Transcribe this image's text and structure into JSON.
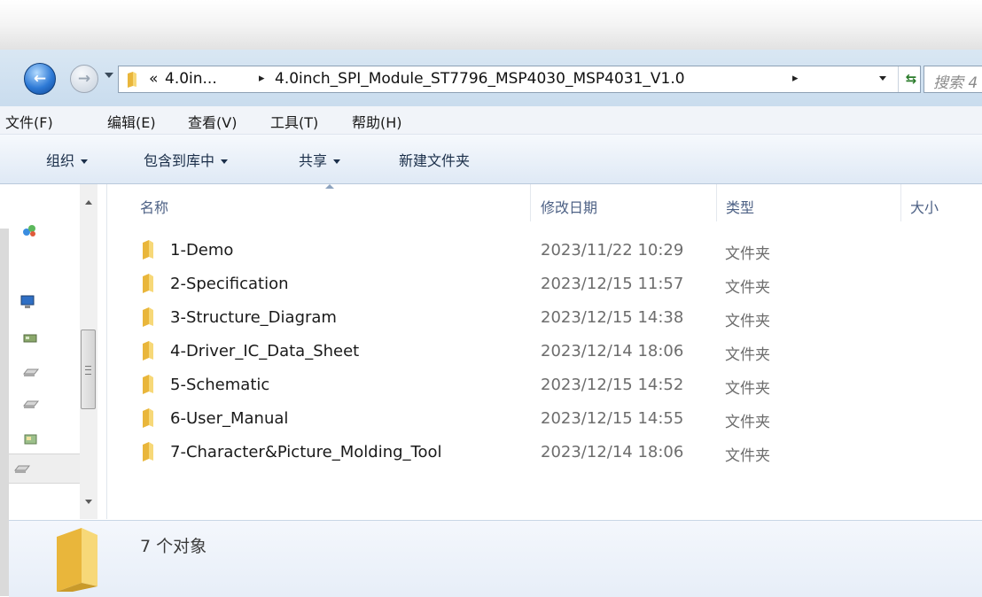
{
  "navigation": {
    "back_icon": "back-arrow-icon",
    "forward_icon": "forward-arrow-icon"
  },
  "address_bar": {
    "prefix": "«",
    "crumbs": [
      "4.0in...",
      "4.0inch_SPI_Module_ST7796_MSP4030_MSP4031_V1.0"
    ],
    "separator": "▸",
    "refresh_icon": "refresh-icon"
  },
  "search": {
    "placeholder": "搜索 4"
  },
  "menu": {
    "items": [
      "文件(F)",
      "编辑(E)",
      "查看(V)",
      "工具(T)",
      "帮助(H)"
    ]
  },
  "command_bar": {
    "items": [
      "组织",
      "包含到库中",
      "共享",
      "新建文件夹"
    ]
  },
  "columns": {
    "name": "名称",
    "date": "修改日期",
    "type": "类型",
    "size": "大小"
  },
  "files": [
    {
      "name": "1-Demo",
      "date": "2023/11/22 10:29",
      "type": "文件夹"
    },
    {
      "name": "2-Specification",
      "date": "2023/12/15 11:57",
      "type": "文件夹"
    },
    {
      "name": "3-Structure_Diagram",
      "date": "2023/12/15 14:38",
      "type": "文件夹"
    },
    {
      "name": "4-Driver_IC_Data_Sheet",
      "date": "2023/12/14 18:06",
      "type": "文件夹"
    },
    {
      "name": "5-Schematic",
      "date": "2023/12/15 14:52",
      "type": "文件夹"
    },
    {
      "name": "6-User_Manual",
      "date": "2023/12/15 14:55",
      "type": "文件夹"
    },
    {
      "name": "7-Character&Picture_Molding_Tool",
      "date": "2023/12/14 18:06",
      "type": "文件夹"
    }
  ],
  "details": {
    "count_text": "7 个对象"
  },
  "colors": {
    "folder_yellow": "#f2c44d",
    "header_text": "#4d6185",
    "accent_blue": "#2e7ad6"
  }
}
